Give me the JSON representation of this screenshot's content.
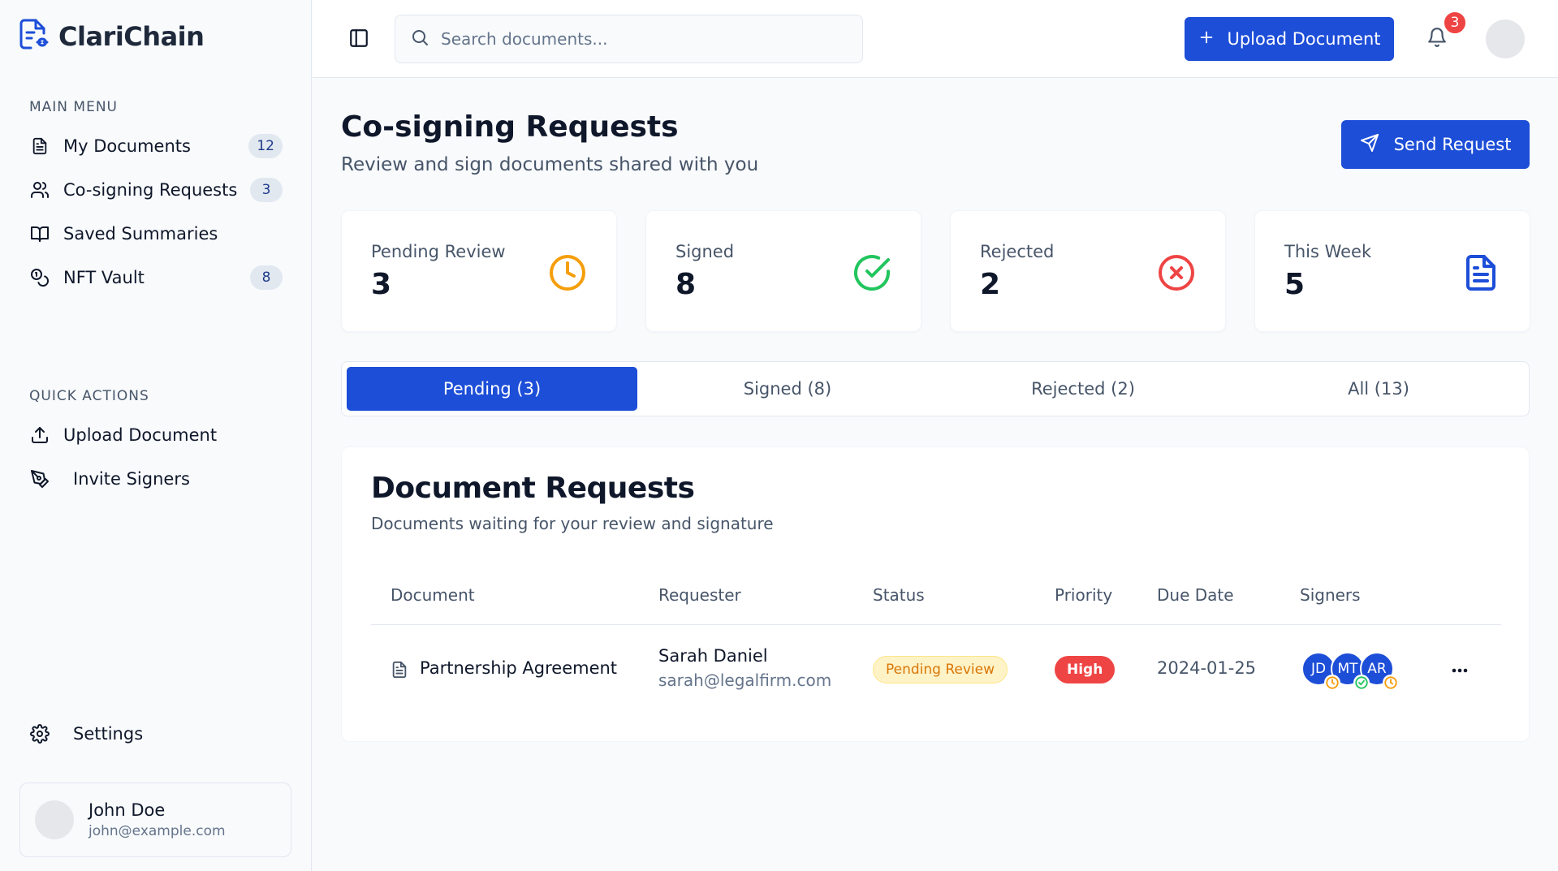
{
  "app": {
    "name": "ClariChain"
  },
  "sidebar": {
    "main_menu_title": "MAIN MENU",
    "main_items": [
      {
        "label": "My Documents",
        "badge": "12",
        "icon": "file-text-icon"
      },
      {
        "label": "Co-signing Requests",
        "badge": "3",
        "icon": "users-icon"
      },
      {
        "label": "Saved Summaries",
        "badge": "",
        "icon": "book-open-icon"
      },
      {
        "label": "NFT Vault",
        "badge": "8",
        "icon": "coins-icon"
      }
    ],
    "quick_actions_title": "QUICK ACTIONS",
    "quick_items": [
      {
        "label": "Upload Document",
        "icon": "upload-icon"
      },
      {
        "label": "Invite Signers",
        "icon": "pen-tool-icon"
      }
    ],
    "settings_label": "Settings",
    "user": {
      "name": "John Doe",
      "email": "john@example.com"
    }
  },
  "header": {
    "search_placeholder": "Search documents...",
    "upload_label": "Upload Document",
    "notification_count": "3"
  },
  "page": {
    "title": "Co-signing Requests",
    "subtitle": "Review and sign documents shared with you",
    "send_request_label": "Send Request"
  },
  "stats": [
    {
      "label": "Pending Review",
      "value": "3",
      "icon": "clock-icon",
      "color": "#f59e0b"
    },
    {
      "label": "Signed",
      "value": "8",
      "icon": "check-circle-icon",
      "color": "#22c55e"
    },
    {
      "label": "Rejected",
      "value": "2",
      "icon": "x-circle-icon",
      "color": "#ef4444"
    },
    {
      "label": "This Week",
      "value": "5",
      "icon": "file-text-icon",
      "color": "#1d4ed8"
    }
  ],
  "tabs": [
    {
      "label": "Pending (3)",
      "active": true
    },
    {
      "label": "Signed (8)",
      "active": false
    },
    {
      "label": "Rejected (2)",
      "active": false
    },
    {
      "label": "All (13)",
      "active": false
    }
  ],
  "requests": {
    "title": "Document Requests",
    "subtitle": "Documents waiting for your review and signature",
    "columns": [
      "Document",
      "Requester",
      "Status",
      "Priority",
      "Due Date",
      "Signers"
    ],
    "rows": [
      {
        "document": "Partnership Agreement",
        "requester_name": "Sarah Daniel",
        "requester_email": "sarah@legalfirm.com",
        "status": "Pending Review",
        "priority": "High",
        "due_date": "2024-01-25",
        "signers": [
          {
            "initials": "JD",
            "state": "pending"
          },
          {
            "initials": "MT",
            "state": "signed"
          },
          {
            "initials": "AR",
            "state": "pending"
          }
        ]
      }
    ]
  },
  "colors": {
    "primary": "#1d4ed8",
    "pending": "#f59e0b",
    "signed": "#22c55e",
    "danger": "#ef4444"
  }
}
